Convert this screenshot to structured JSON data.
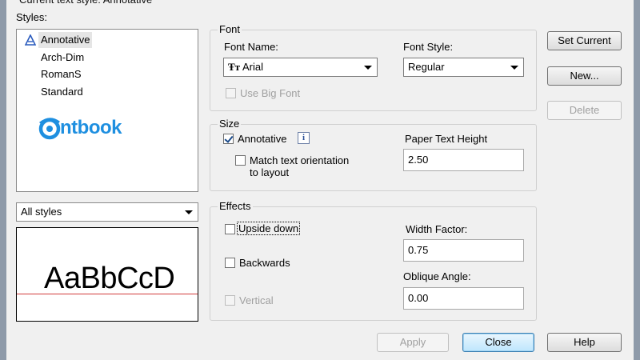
{
  "header": {
    "current_style": "Current text style:  Annotative"
  },
  "styles": {
    "label": "Styles:",
    "items": [
      {
        "label": "Annotative",
        "icon": "annotative-icon"
      },
      {
        "label": "Arch-Dim"
      },
      {
        "label": "RomanS"
      },
      {
        "label": "Standard"
      }
    ],
    "watermark_logo": "ntbook",
    "filter": {
      "value": "All styles"
    }
  },
  "preview": {
    "sample": "AaBbCcD"
  },
  "font": {
    "title": "Font",
    "font_name_label": "Font Name:",
    "font_name_value": "Arial",
    "font_style_label": "Font Style:",
    "font_style_value": "Regular",
    "big_font_label": "Use Big Font"
  },
  "size": {
    "title": "Size",
    "annotative_label": "Annotative",
    "match_label_line1": "Match text orientation",
    "match_label_line2": "to layout",
    "paper_height_label": "Paper Text Height",
    "paper_height_value": "2.50"
  },
  "effects": {
    "title": "Effects",
    "upside_down_label": "Upside down",
    "backwards_label": "Backwards",
    "vertical_label": "Vertical",
    "width_factor_label": "Width Factor:",
    "width_factor_value": "0.75",
    "oblique_label": "Oblique Angle:",
    "oblique_value": "0.00"
  },
  "buttons": {
    "set_current": "Set Current",
    "new": "New...",
    "delete": "Delete",
    "apply": "Apply",
    "close": "Close",
    "help": "Help"
  },
  "colors": {
    "accent": "#3c7fb1",
    "preview_baseline": "#d23b3b",
    "logo": "#1e8fe0"
  }
}
